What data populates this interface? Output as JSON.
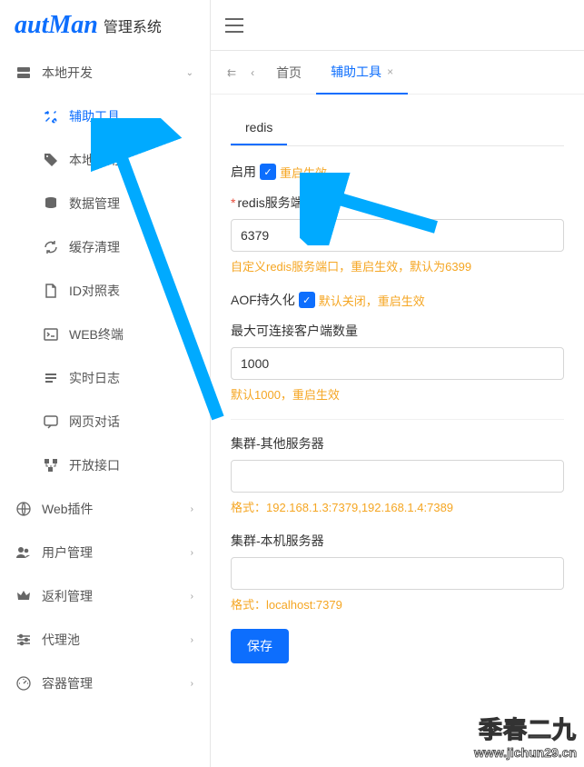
{
  "logo": {
    "brand": "autMan",
    "sub": "管理系统"
  },
  "sidebar": {
    "top": {
      "label": "本地开发"
    },
    "sub": [
      {
        "label": "辅助工具",
        "active": true
      },
      {
        "label": "本地应用"
      },
      {
        "label": "数据管理"
      },
      {
        "label": "缓存清理"
      },
      {
        "label": "ID对照表"
      },
      {
        "label": "WEB终端"
      },
      {
        "label": "实时日志"
      },
      {
        "label": "网页对话"
      },
      {
        "label": "开放接口"
      }
    ],
    "rest": [
      {
        "label": "Web插件"
      },
      {
        "label": "用户管理"
      },
      {
        "label": "返利管理"
      },
      {
        "label": "代理池"
      },
      {
        "label": "容器管理"
      }
    ]
  },
  "tabs": {
    "home": "首页",
    "current": "辅助工具"
  },
  "subtab": "redis",
  "form": {
    "enable_label": "启用",
    "enable_hint": "重启生效",
    "port_label": "redis服务端口",
    "port_value": "6379",
    "port_hint": "自定义redis服务端口，重启生效，默认为6399",
    "aof_label": "AOF持久化",
    "aof_hint": "默认关闭，重启生效",
    "maxconn_label": "最大可连接客户端数量",
    "maxconn_value": "1000",
    "maxconn_hint": "默认1000，重启生效",
    "cluster_other_label": "集群-其他服务器",
    "cluster_other_value": "",
    "cluster_other_hint": "格式：192.168.1.3:7379,192.168.1.4:7389",
    "cluster_self_label": "集群-本机服务器",
    "cluster_self_value": "",
    "cluster_self_hint": "格式：localhost:7379",
    "save_btn": "保存"
  },
  "watermark": {
    "line1": "季春二九",
    "line2": "www.jichun29.cn"
  }
}
